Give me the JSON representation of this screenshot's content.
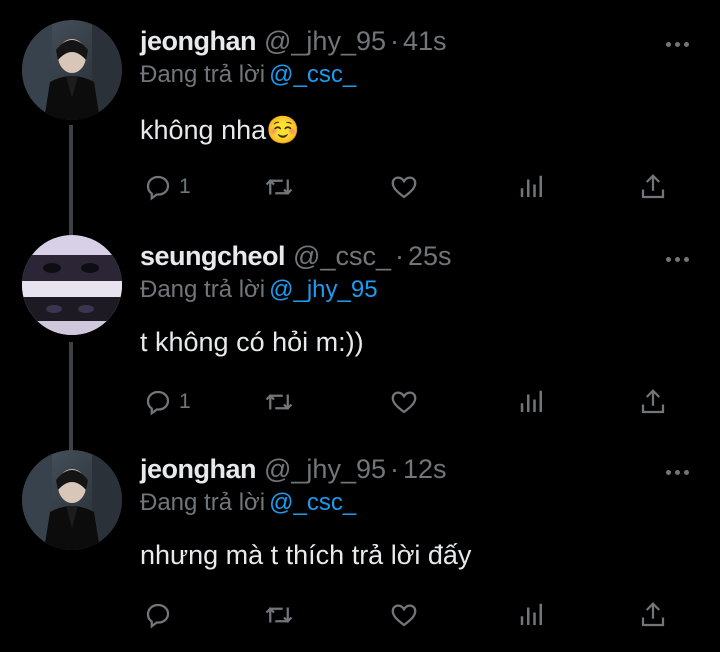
{
  "reply_label": "Đang trả lời",
  "tweets": [
    {
      "author_name": "jeonghan",
      "handle": "@_jhy_95",
      "time": "41s",
      "replying_to": "@_csc_",
      "text": "không nha☺️",
      "reply_count": "1"
    },
    {
      "author_name": "seungcheol",
      "handle": "@_csc_",
      "time": "25s",
      "replying_to": "@_jhy_95",
      "text": "t không có hỏi m:))",
      "reply_count": "1"
    },
    {
      "author_name": "jeonghan",
      "handle": "@_jhy_95",
      "time": "12s",
      "replying_to": "@_csc_",
      "text": "nhưng mà t thích trả lời đấy",
      "reply_count": ""
    }
  ],
  "icons": {
    "reply": "reply-icon",
    "retweet": "retweet-icon",
    "like": "heart-icon",
    "views": "analytics-icon",
    "share": "share-icon",
    "more": "more-icon"
  },
  "colors": {
    "background": "#000000",
    "text": "#e7e9ea",
    "muted": "#71767b",
    "accent": "#1d9bf0"
  }
}
